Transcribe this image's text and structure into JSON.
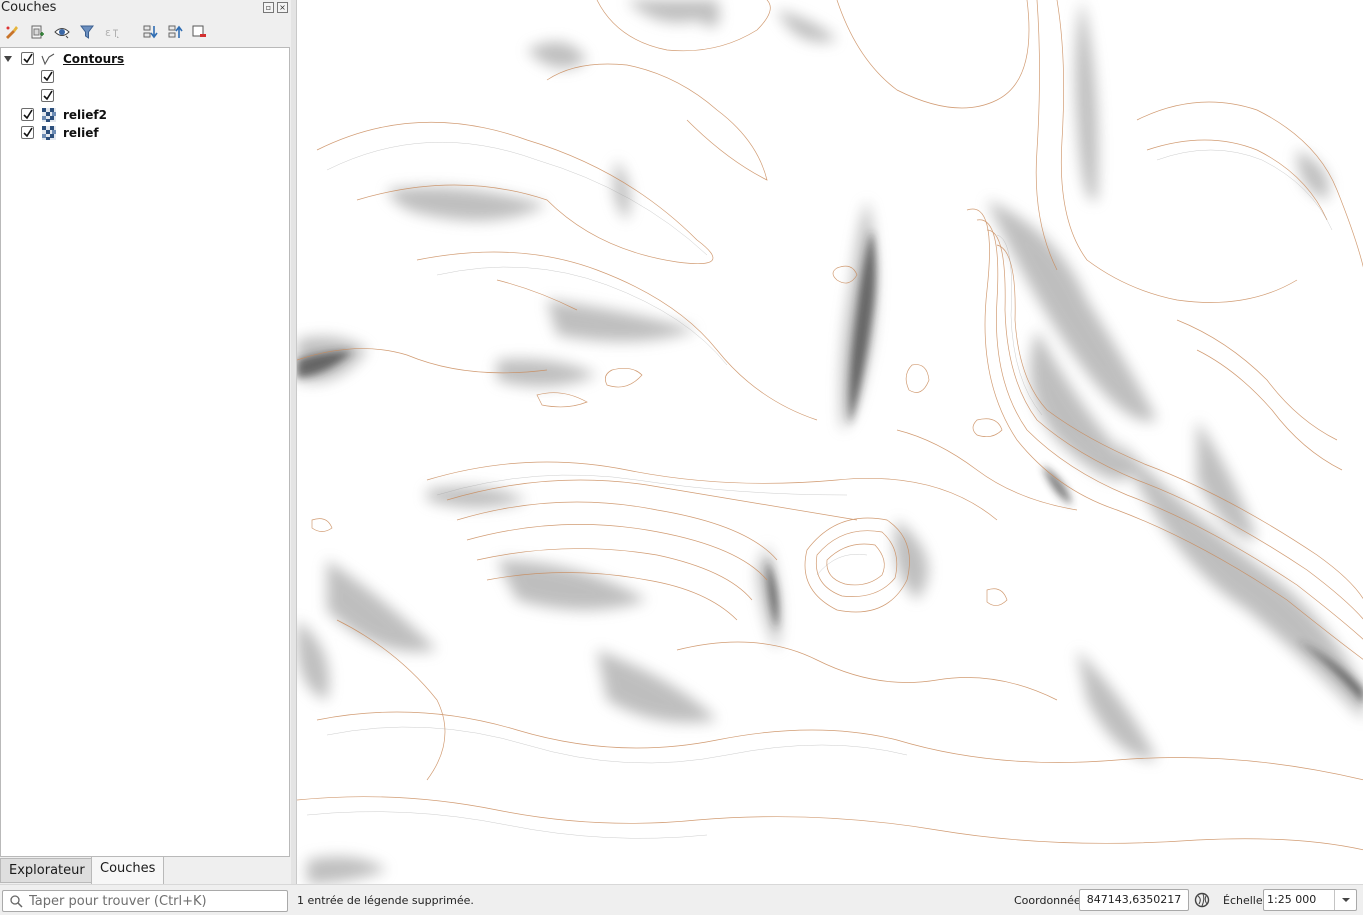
{
  "panel": {
    "title": "Couches",
    "toolbar": [
      {
        "name": "open-styling-icon"
      },
      {
        "name": "add-group-icon"
      },
      {
        "name": "manage-visibility-icon"
      },
      {
        "name": "filter-legend-icon"
      },
      {
        "name": "filter-by-expression-icon"
      },
      {
        "name": "expand-all-icon"
      },
      {
        "name": "collapse-all-icon"
      },
      {
        "name": "remove-layer-icon"
      }
    ],
    "layers": [
      {
        "label": "Contours",
        "checked": true,
        "type": "vector-line",
        "expanded": true
      },
      {
        "label": "",
        "checked": true,
        "type": "legend-item"
      },
      {
        "label": "",
        "checked": true,
        "type": "legend-item"
      },
      {
        "label": "relief2",
        "checked": true,
        "type": "raster"
      },
      {
        "label": "relief",
        "checked": true,
        "type": "raster"
      }
    ]
  },
  "dock_tabs": {
    "explorer": "Explorateur",
    "layers": "Couches"
  },
  "statusbar": {
    "locator_placeholder": "Taper pour trouver (Ctrl+K)",
    "message": "1 entrée de légende supprimée.",
    "coordinate_label": "Coordonnée",
    "coordinate_value": "847143,6350217",
    "scale_label": "Échelle",
    "scale_value": "1:25 000"
  },
  "colors": {
    "contour": "#c98a5a",
    "hillshade": "#5a5a5a",
    "tree_background": "#ffffff",
    "panel_background": "#efefef"
  }
}
